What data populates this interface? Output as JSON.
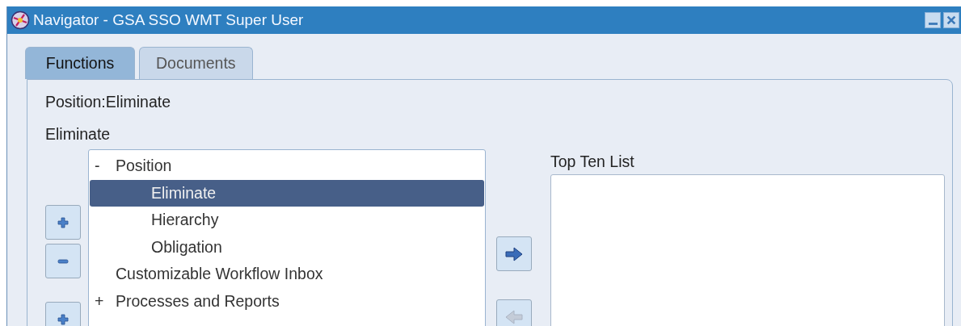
{
  "window": {
    "title": "Navigator - GSA SSO WMT Super User"
  },
  "tabs": [
    {
      "label": "Functions",
      "selected": true
    },
    {
      "label": "Documents",
      "selected": false
    }
  ],
  "path": "Position:Eliminate",
  "description": "Eliminate",
  "tree_buttons": [
    {
      "kind": "expand",
      "disabled": false
    },
    {
      "kind": "collapse",
      "disabled": false
    },
    {
      "kind": "expand_all",
      "disabled": false
    }
  ],
  "tree": [
    {
      "marker": "-",
      "label": "Position",
      "expanded": true,
      "selected": false,
      "children": [
        {
          "label": "Eliminate",
          "selected": true
        },
        {
          "label": "Hierarchy",
          "selected": false
        },
        {
          "label": "Obligation",
          "selected": false
        }
      ]
    },
    {
      "label": "Customizable Workflow Inbox",
      "selected": false
    },
    {
      "marker": "+",
      "label": "Processes and Reports",
      "expanded": false,
      "selected": false
    }
  ],
  "move_buttons": [
    {
      "kind": "add",
      "disabled": false
    },
    {
      "kind": "remove",
      "disabled": true
    }
  ],
  "top_ten": {
    "label": "Top Ten List"
  }
}
